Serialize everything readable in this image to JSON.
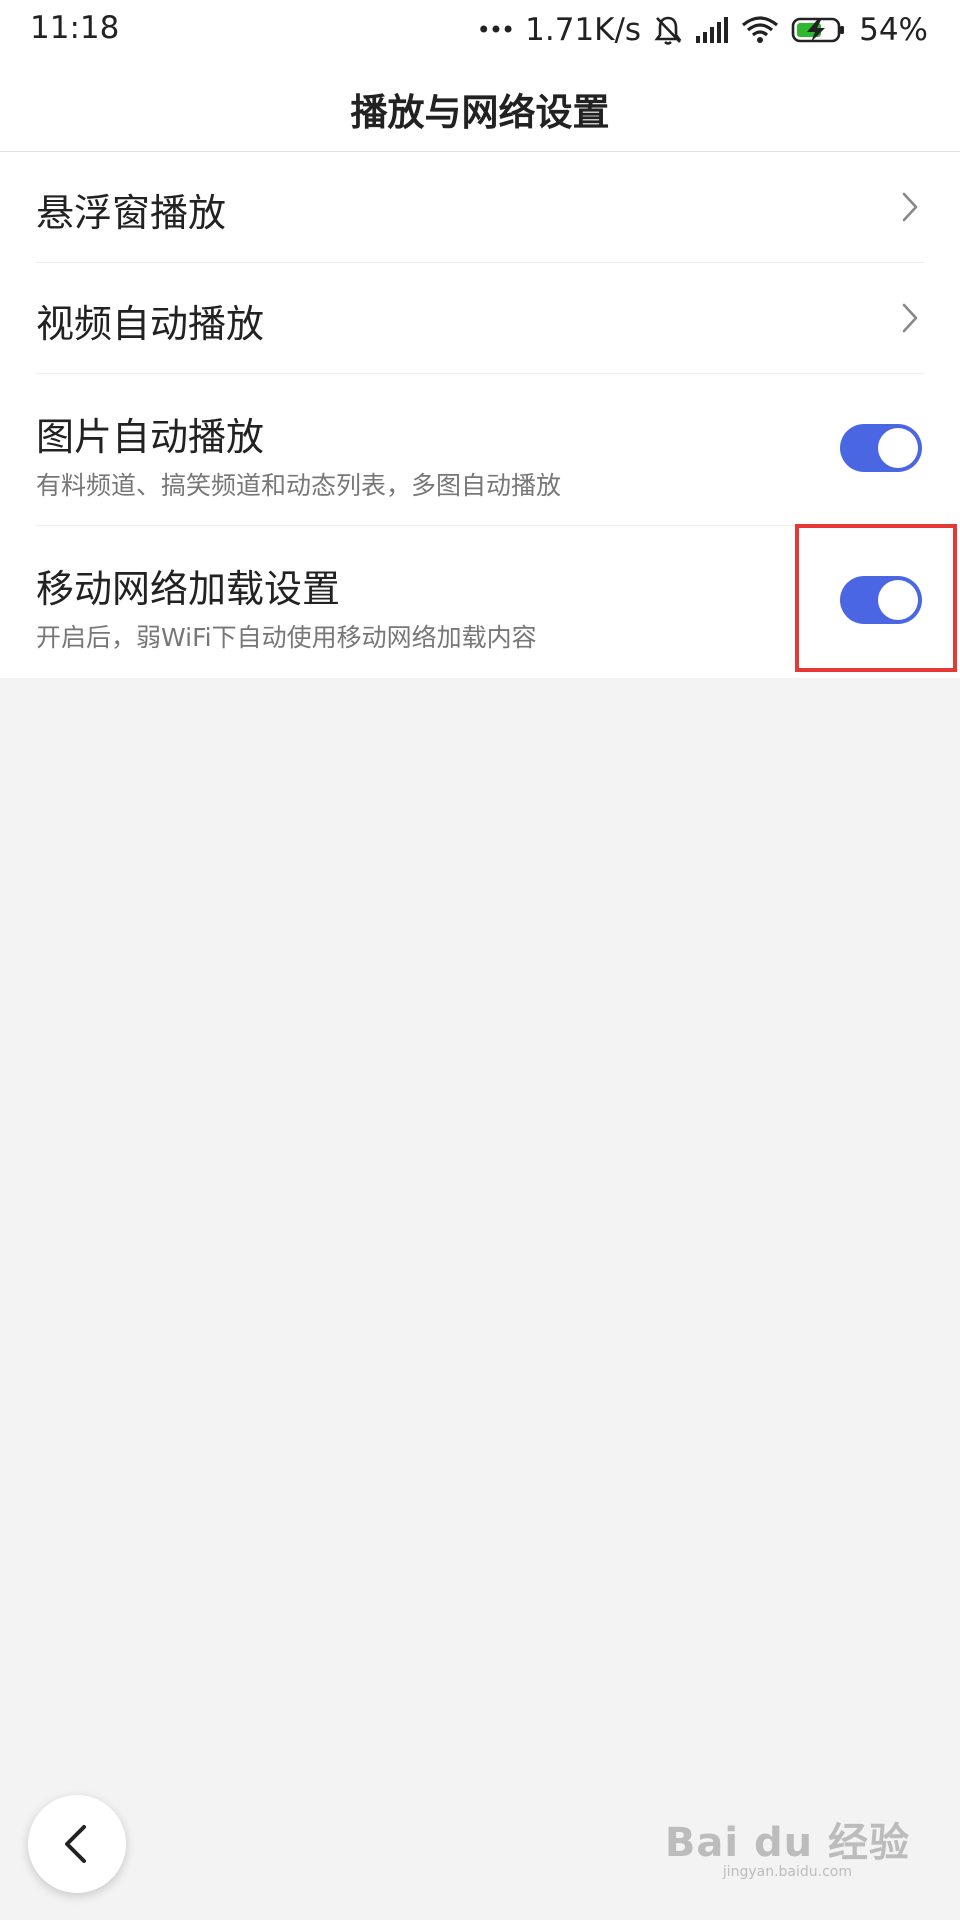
{
  "status_bar": {
    "time": "11:18",
    "dots": "•••",
    "speed": "1.71K/s",
    "battery": "54%",
    "icons": [
      "bell-muted-icon",
      "signal-icon",
      "wifi-icon",
      "battery-charging-icon"
    ]
  },
  "header": {
    "title": "播放与网络设置"
  },
  "settings": [
    {
      "title": "悬浮窗播放",
      "type": "chevron",
      "icon": "chevron-right-icon"
    },
    {
      "title": "视频自动播放",
      "type": "chevron",
      "icon": "chevron-right-icon"
    },
    {
      "title": "图片自动播放",
      "subtitle": "有料频道、搞笑频道和动态列表，多图自动播放",
      "type": "toggle",
      "on": true
    },
    {
      "title": "移动网络加载设置",
      "subtitle": "开启后，弱WiFi下自动使用移动网络加载内容",
      "type": "toggle",
      "on": true
    }
  ],
  "colors": {
    "toggle_on": "#4a66e3",
    "highlight": "#e53935",
    "battery_charge": "#2fb82f"
  },
  "footer": {
    "back_icon": "chevron-left-icon",
    "watermark": "Bai du 经验",
    "watermark_url": "jingyan.baidu.com"
  }
}
